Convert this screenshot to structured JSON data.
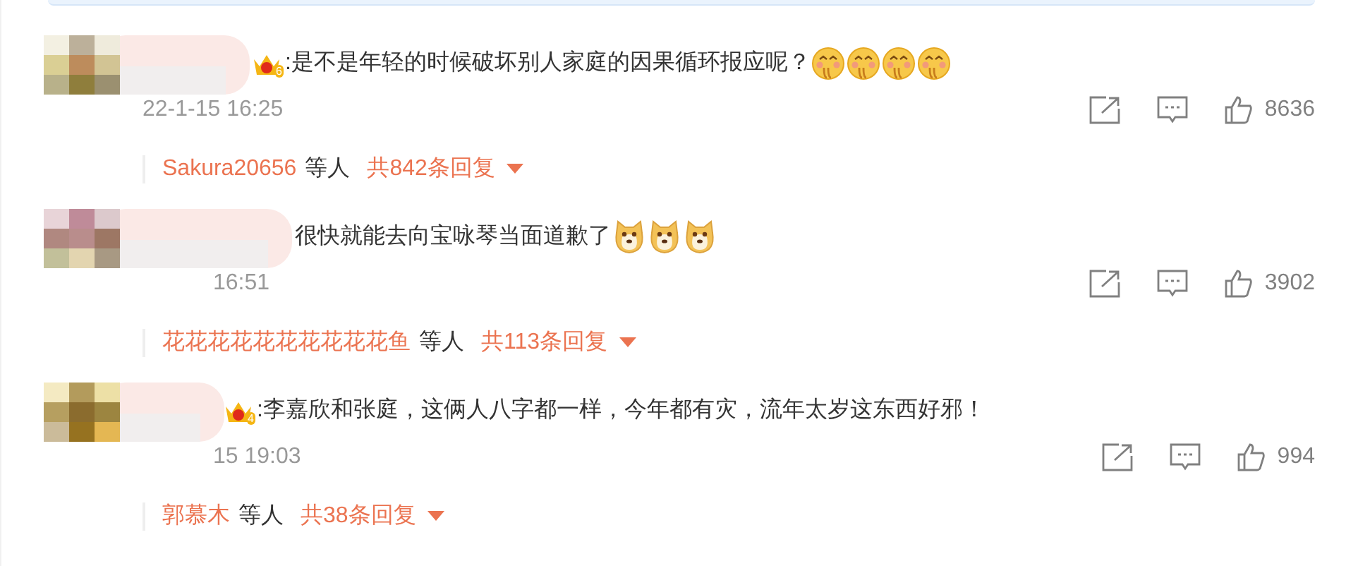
{
  "comments": [
    {
      "vip_level": "6",
      "text": ":是不是年轻的时候破坏别人家庭的因果循环报应呢？",
      "emojis": [
        {
          "kind": "blush"
        },
        {
          "kind": "blush"
        },
        {
          "kind": "blush"
        },
        {
          "kind": "blush"
        }
      ],
      "time": "22-1-15 16:25",
      "likes": "8636",
      "replies": {
        "names": "Sakura20656",
        "others": "等人",
        "total": "共842条回复"
      }
    },
    {
      "text": "很快就能去向宝咏琴当面道歉了",
      "emojis": [
        {
          "kind": "dog"
        },
        {
          "kind": "dog"
        },
        {
          "kind": "dog"
        }
      ],
      "time": "16:51",
      "likes": "3902",
      "replies": {
        "names": "花花花花花花花花花花鱼",
        "others": "等人",
        "total": "共113条回复"
      }
    },
    {
      "vip_level": "4",
      "text": ":李嘉欣和张庭，这俩人八字都一样，今年都有灾，流年太岁这东西好邪！",
      "time": "15 19:03",
      "likes": "994",
      "replies": {
        "names": "郭慕木",
        "others": "等人",
        "total": "共38条回复"
      }
    }
  ]
}
